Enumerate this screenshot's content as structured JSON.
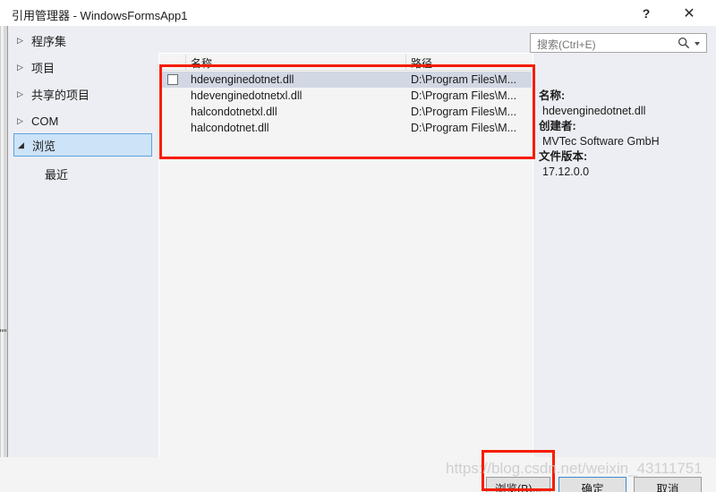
{
  "window": {
    "title": "引用管理器 - WindowsFormsApp1",
    "help_icon": "question-mark-icon",
    "close_icon": "close-icon"
  },
  "search": {
    "placeholder": "搜索(Ctrl+E)",
    "value": "",
    "icon": "search-icon",
    "caret_icon": "chevron-down-icon"
  },
  "sidebar": {
    "items": [
      {
        "label": "程序集",
        "marker": "▷",
        "selected": false,
        "child": false
      },
      {
        "label": "项目",
        "marker": "▷",
        "selected": false,
        "child": false
      },
      {
        "label": "共享的项目",
        "marker": "▷",
        "selected": false,
        "child": false
      },
      {
        "label": "COM",
        "marker": "▷",
        "selected": false,
        "child": false
      },
      {
        "label": "浏览",
        "marker": "◢",
        "selected": true,
        "child": false
      },
      {
        "label": "最近",
        "marker": "",
        "selected": false,
        "child": true
      }
    ]
  },
  "list": {
    "columns": {
      "name": "名称",
      "path": "路径"
    },
    "rows": [
      {
        "name": "hdevenginedotnet.dll",
        "path": "D:\\Program Files\\M...",
        "selected": true,
        "checked": false,
        "has_checkbox": true
      },
      {
        "name": "hdevenginedotnetxl.dll",
        "path": "D:\\Program Files\\M...",
        "selected": false,
        "checked": false,
        "has_checkbox": false
      },
      {
        "name": "halcondotnetxl.dll",
        "path": "D:\\Program Files\\M...",
        "selected": false,
        "checked": false,
        "has_checkbox": false
      },
      {
        "name": "halcondotnet.dll",
        "path": "D:\\Program Files\\M...",
        "selected": false,
        "checked": false,
        "has_checkbox": false
      }
    ]
  },
  "details": {
    "fields": [
      {
        "label": "名称:",
        "value": "hdevenginedotnet.dll"
      },
      {
        "label": "创建者:",
        "value": "MVTec Software GmbH"
      },
      {
        "label": "文件版本:",
        "value": "17.12.0.0"
      }
    ]
  },
  "buttons": {
    "browse": "浏览(B)...",
    "ok": "确定",
    "cancel": "取消"
  },
  "annotations": {
    "highlight_color": "#f61c00",
    "watermark": "https://blog.csdn.net/weixin_43111751"
  }
}
